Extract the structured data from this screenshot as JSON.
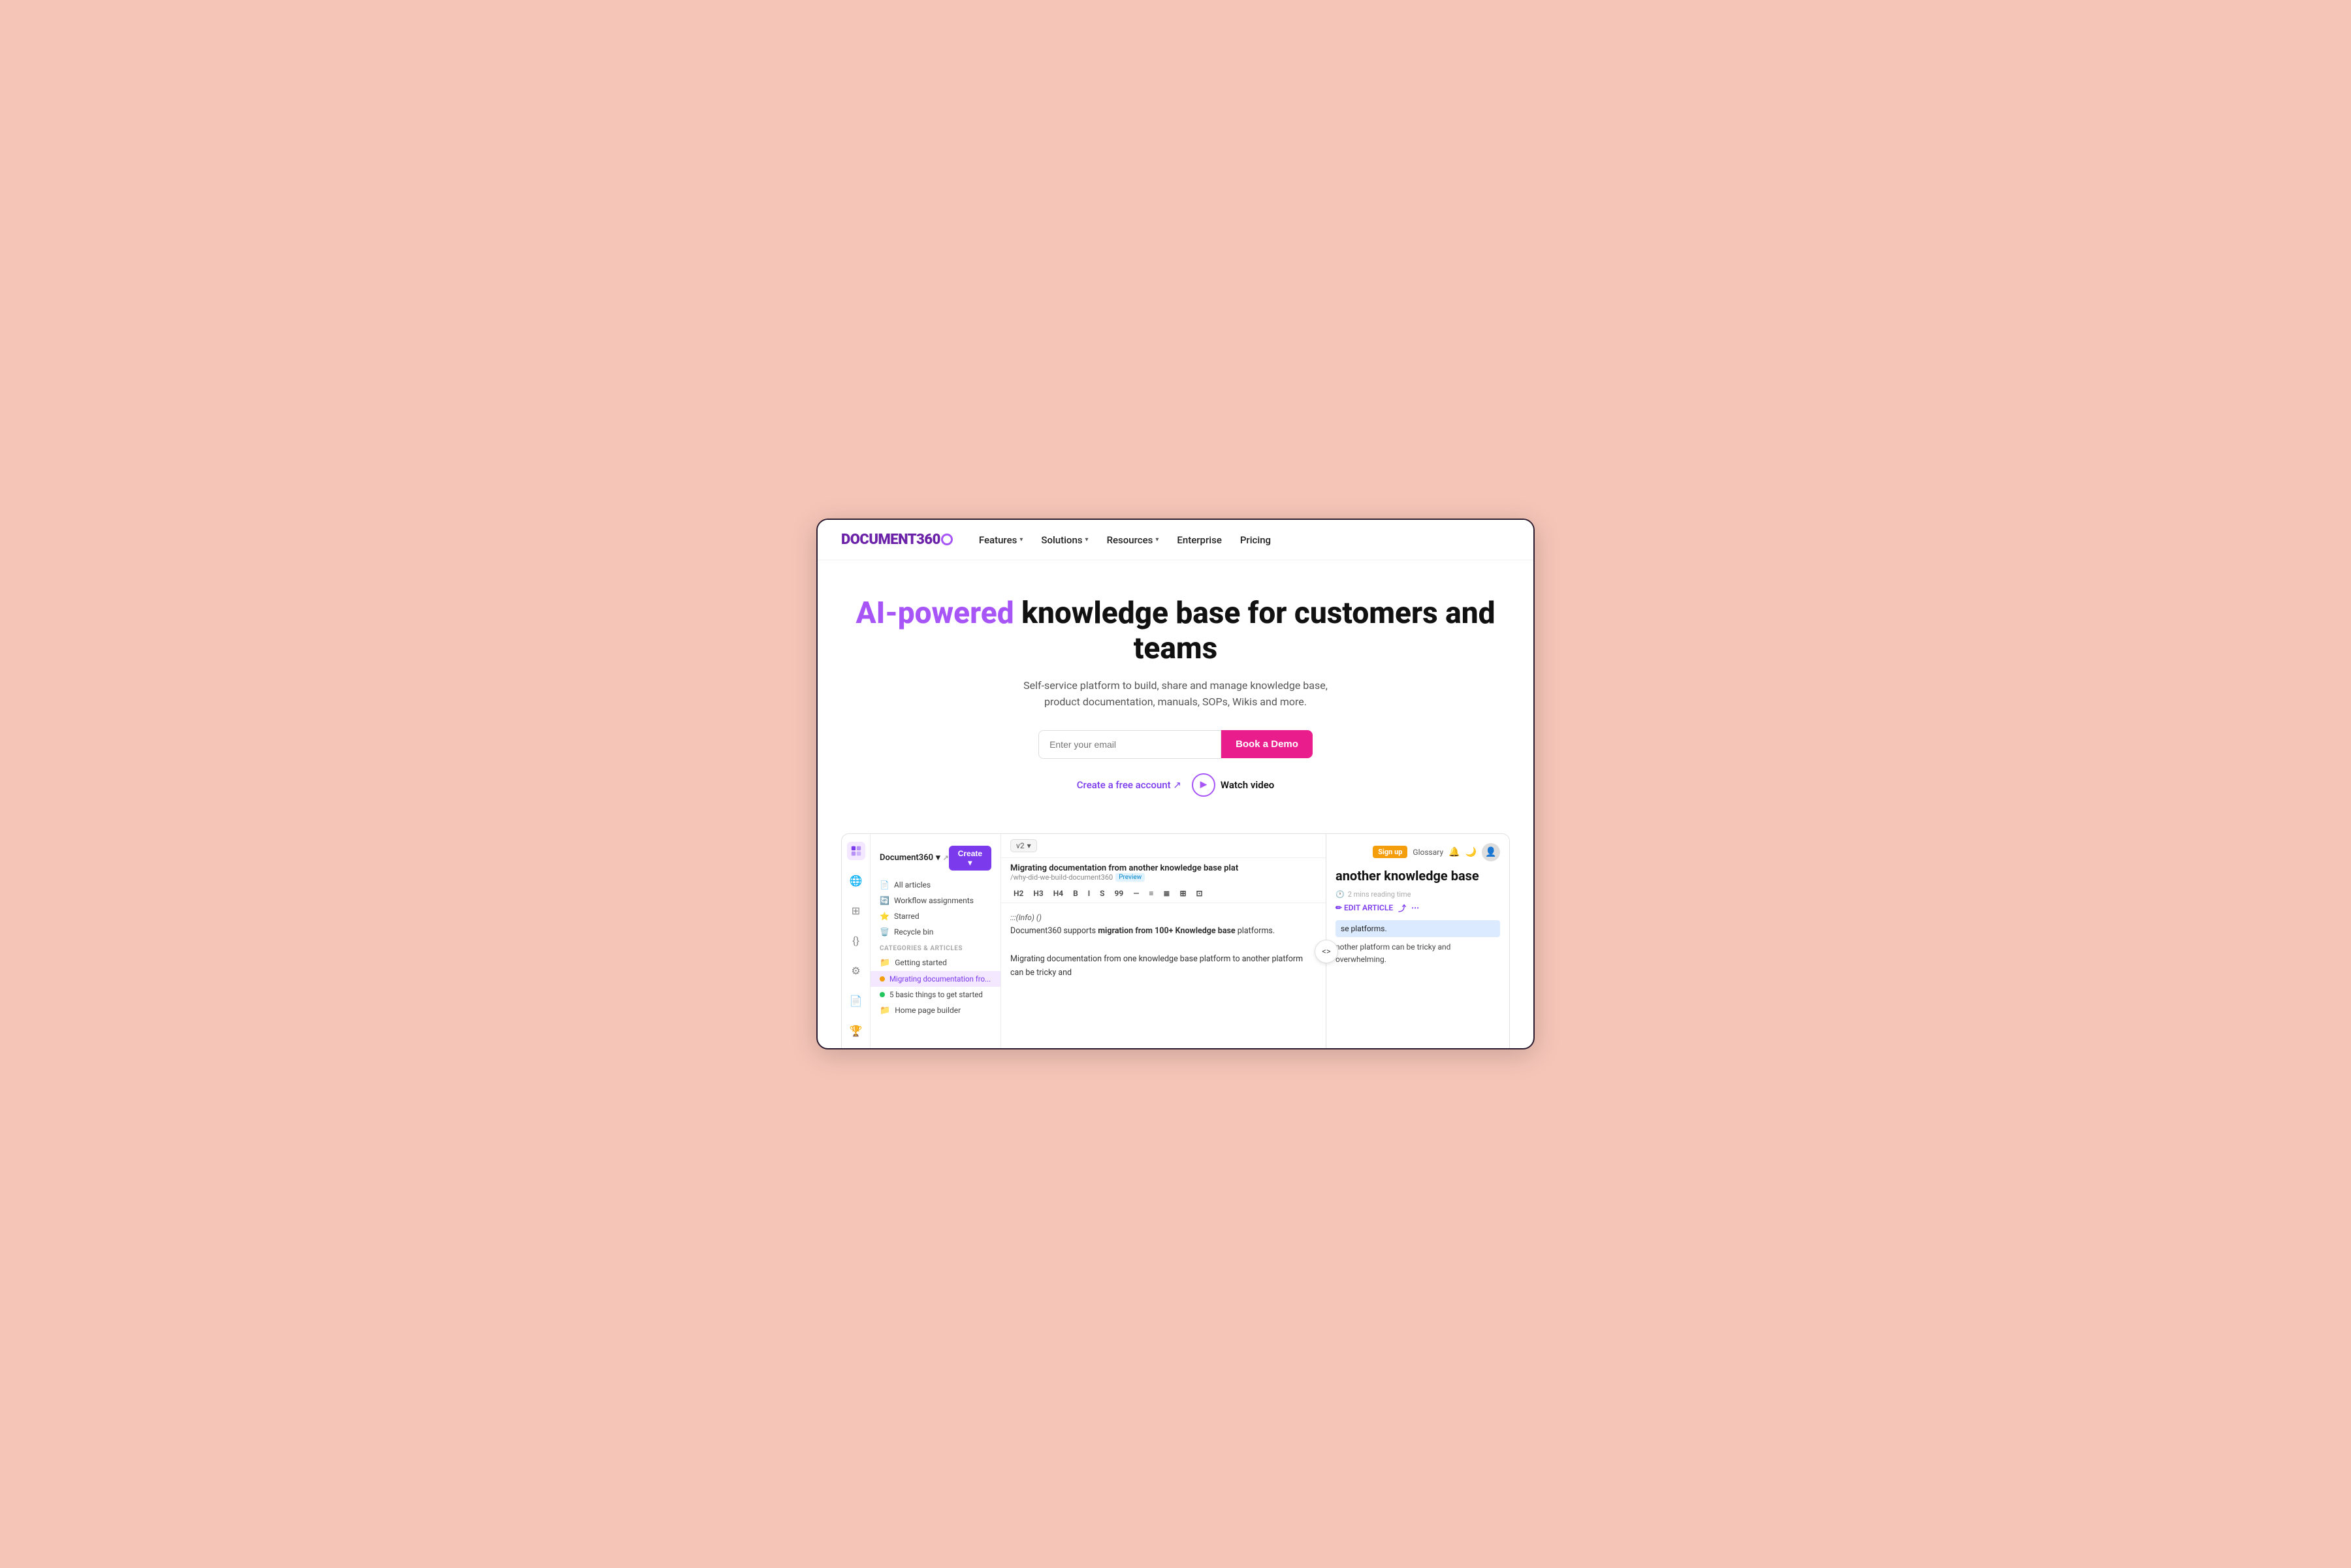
{
  "page": {
    "background_color": "#f5c5b8"
  },
  "navbar": {
    "logo_text": "DOCUMENT360",
    "nav_items": [
      {
        "label": "Features",
        "has_dropdown": true
      },
      {
        "label": "Solutions",
        "has_dropdown": true
      },
      {
        "label": "Resources",
        "has_dropdown": true
      },
      {
        "label": "Enterprise",
        "has_dropdown": false
      },
      {
        "label": "Pricing",
        "has_dropdown": false
      }
    ]
  },
  "hero": {
    "heading_part1": "AI-powered",
    "heading_part2": " knowledge base for customers and teams",
    "subtitle": "Self-service platform to build, share and manage knowledge base, product documentation, manuals, SOPs, Wikis and more.",
    "email_placeholder": "Enter your email",
    "demo_button_label": "Book a Demo",
    "create_account_label": "Create a free account ↗",
    "watch_video_label": "Watch video"
  },
  "app_ui": {
    "doc_title": "Document360",
    "version": "v2",
    "create_button": "Create ▾",
    "nav_items": [
      {
        "label": "All articles",
        "icon": "📄"
      },
      {
        "label": "Workflow assignments",
        "icon": "🔄"
      },
      {
        "label": "Starred",
        "icon": "⭐"
      },
      {
        "label": "Recycle bin",
        "icon": "🗑️"
      }
    ],
    "categories_label": "CATEGORIES & ARTICLES",
    "articles": [
      {
        "label": "Getting started",
        "type": "folder"
      },
      {
        "label": "Migrating documentation fro...",
        "type": "dot-yellow",
        "active": true
      },
      {
        "label": "5 basic things to get started",
        "type": "dot-green"
      },
      {
        "label": "Home page builder",
        "type": "folder"
      }
    ],
    "editor": {
      "article_title": "Migrating documentation from another knowledge base plat",
      "article_url": "/why-did-we-build-document360",
      "preview_badge": "Preview",
      "toolbar": [
        "H2",
        "H3",
        "H4",
        "B",
        "I",
        "S",
        "99",
        "—",
        "≡",
        "≣",
        "⊞",
        "⊡"
      ],
      "content_info": ":::(Info) ()",
      "content_bold": "migration from 100+ Knowledge base",
      "content_suffix": " platforms.",
      "content_body": "Migrating documentation from one knowledge base platform to another platform can be tricky and"
    },
    "preview": {
      "sign_up": "Sign up",
      "glossary": "Glossary",
      "heading": "another knowledge base",
      "reading_time": "2 mins reading time",
      "edit_article": "✏ EDIT ARTICLE",
      "highlight_text": "se platforms.",
      "body_text": "nother platform can be tricky and overwhelming."
    }
  }
}
